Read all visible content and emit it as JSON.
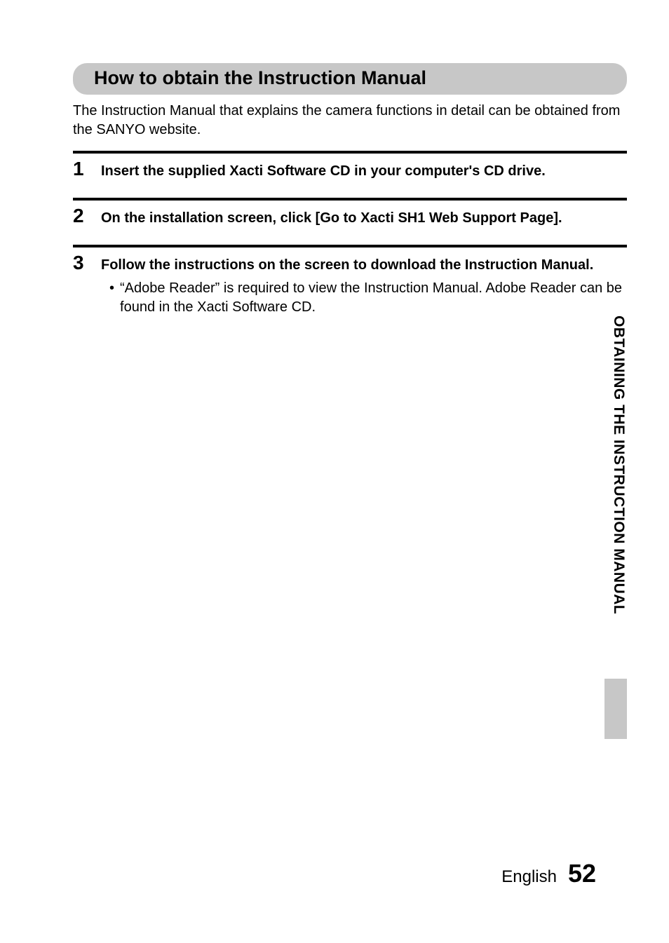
{
  "heading": "How to obtain the Instruction Manual",
  "intro": "The Instruction Manual that explains the camera functions in detail can be obtained from the SANYO website.",
  "steps": [
    {
      "number": "1",
      "instruction": "Insert the supplied Xacti Software CD in your computer's CD drive."
    },
    {
      "number": "2",
      "instruction": "On the installation screen, click [Go to Xacti SH1 Web Support Page]."
    },
    {
      "number": "3",
      "instruction": "Follow the instructions on the screen to download the Instruction Manual.",
      "bullet": "“Adobe Reader” is required to view the Instruction Manual. Adobe Reader can be found in the Xacti Software CD."
    }
  ],
  "side_tab": "OBTAINING THE INSTRUCTION MANUAL",
  "footer": {
    "language": "English",
    "page": "52"
  }
}
